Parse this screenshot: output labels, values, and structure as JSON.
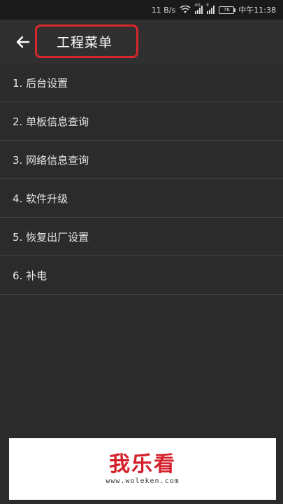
{
  "status_bar": {
    "speed": "11 B/s",
    "sim1_tag": "4G",
    "sim2_tag": "E",
    "battery": "76",
    "time": "中午11:38"
  },
  "toolbar": {
    "title": "工程菜单",
    "back_icon": "arrow-left-icon"
  },
  "menu": [
    {
      "label": "1. 后台设置"
    },
    {
      "label": "2. 单板信息查询"
    },
    {
      "label": "3. 网络信息查询"
    },
    {
      "label": "4. 软件升级"
    },
    {
      "label": "5. 恢复出厂设置"
    },
    {
      "label": "6. 补电"
    }
  ],
  "watermark": {
    "logo": "我乐看",
    "url": "www.woleken.com"
  },
  "colors": {
    "background": "#2b2b2b",
    "highlight": "#d9262c",
    "logo": "#d4202a"
  }
}
